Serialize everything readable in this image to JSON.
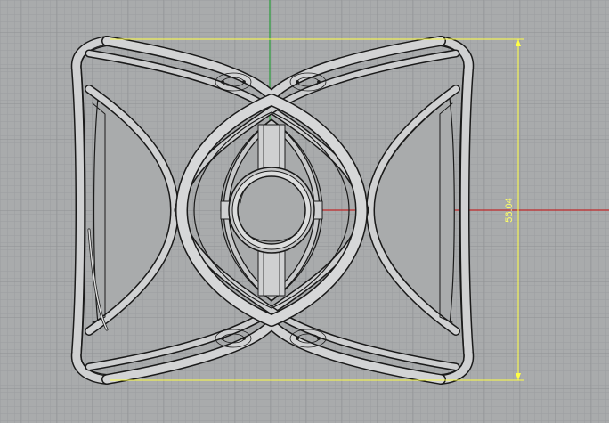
{
  "viewport": {
    "background_color": "#a9abac",
    "grid_minor_color": "#9c9ea0",
    "grid_major_color": "#8d8f91",
    "x_axis_color": "#c0282a",
    "y_axis_color": "#2a9c3a"
  },
  "model": {
    "fill_color": "#c9cacb",
    "edge_color": "#1a1a1a",
    "highlight_color": "#eeeeee"
  },
  "dimension": {
    "value": "56.04",
    "color": "#ffff44"
  }
}
